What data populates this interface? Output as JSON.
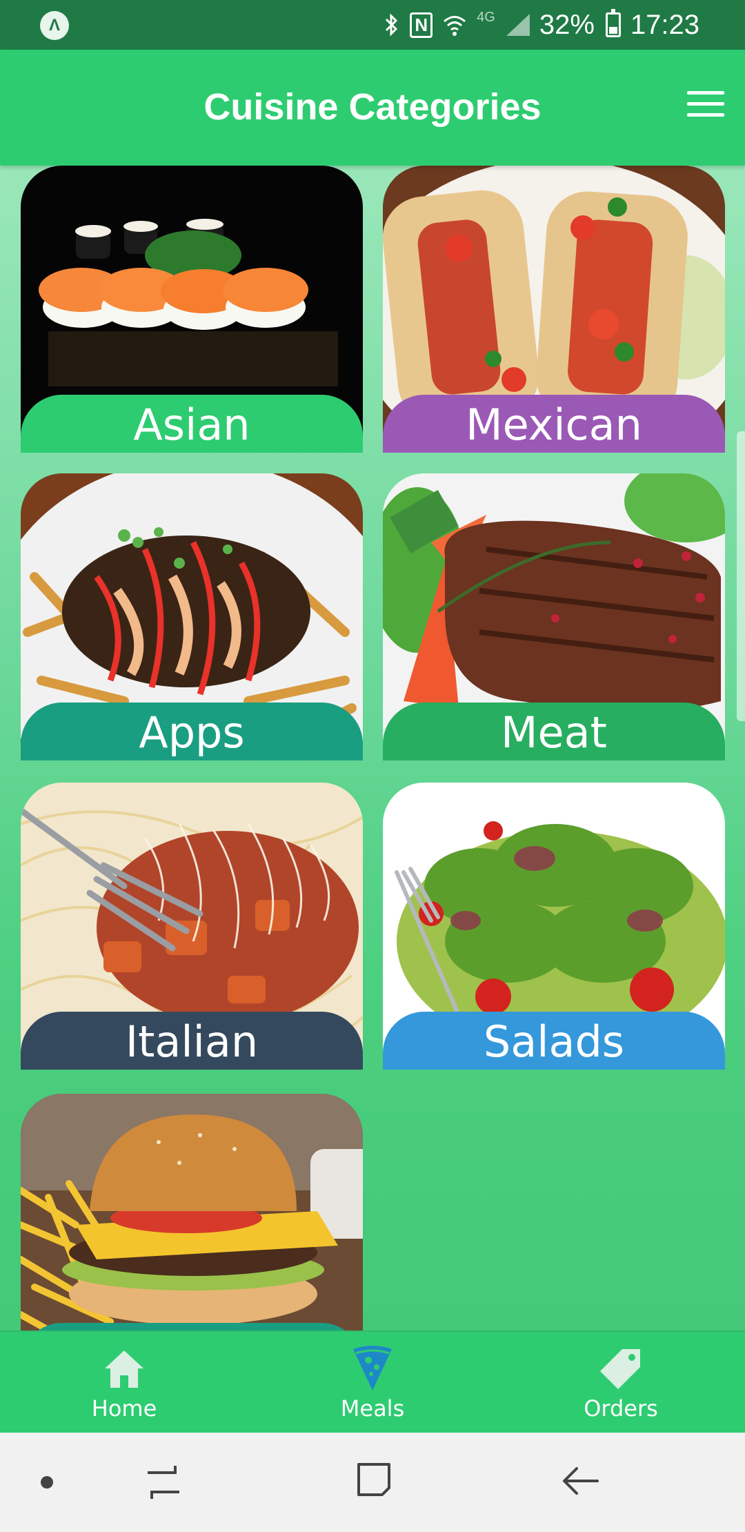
{
  "status_bar": {
    "app_badge": "Λ",
    "icons": [
      "bluetooth-icon",
      "nfc-icon",
      "wifi-icon",
      "lte-icon",
      "signal-icon",
      "battery-icon"
    ],
    "nfc": "N",
    "network": "4G",
    "battery": "32%",
    "battery_level": 0.32,
    "time": "17:23"
  },
  "header": {
    "title": "Cuisine Categories",
    "menu_icon": "hamburger-menu-icon"
  },
  "categories": [
    {
      "label": "Asian",
      "color": "#2ecc71",
      "image": "sushi-photo"
    },
    {
      "label": "Mexican",
      "color": "#9b59b6",
      "image": "tacos-photo"
    },
    {
      "label": "Apps",
      "color": "#1a9e82",
      "image": "loaded-fries-photo"
    },
    {
      "label": "Meat",
      "color": "#27ae60",
      "image": "steak-photo"
    },
    {
      "label": "Italian",
      "color": "#34495e",
      "image": "spaghetti-photo"
    },
    {
      "label": "Salads",
      "color": "#3498db",
      "image": "salad-photo"
    },
    {
      "label": "",
      "color": "#1a9e82",
      "image": "burger-photo"
    }
  ],
  "tabs": [
    {
      "label": "Home",
      "icon": "home-icon",
      "active": false
    },
    {
      "label": "Meals",
      "icon": "pizza-slice-icon",
      "active": true
    },
    {
      "label": "Orders",
      "icon": "tag-icon",
      "active": false
    }
  ],
  "colors": {
    "header": "#2ecc71",
    "status_bar": "#1f7a45",
    "active_tab": "#1e88c7",
    "inactive_tab": "#dcefe3"
  },
  "nav_bar": [
    "dot-icon",
    "recent-apps-icon",
    "home-square-icon",
    "back-arrow-icon"
  ]
}
